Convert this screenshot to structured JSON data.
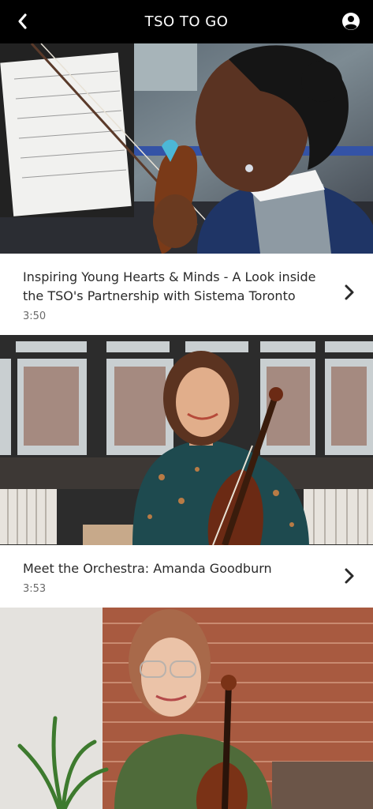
{
  "header": {
    "title": "TSO TO GO",
    "back_icon": "chevron-left-icon",
    "account_icon": "account-circle-icon"
  },
  "videos": [
    {
      "title": "Inspiring Young Hearts & Minds - A Look inside the TSO's Partnership with Sistema Toronto",
      "duration": "3:50",
      "thumbnail": "girl playing violin with music stand"
    },
    {
      "title": "Meet the Orchestra: Amanda Goodburn",
      "duration": "3:53",
      "thumbnail": "woman with violin in front of window"
    },
    {
      "title": "",
      "duration": "",
      "thumbnail": "woman with glasses holding violin before brick wall"
    }
  ],
  "colors": {
    "header_bg": "#000000",
    "header_text": "#ffffff",
    "title_text": "#2a2a2a",
    "duration_text": "#6a6a6a"
  }
}
